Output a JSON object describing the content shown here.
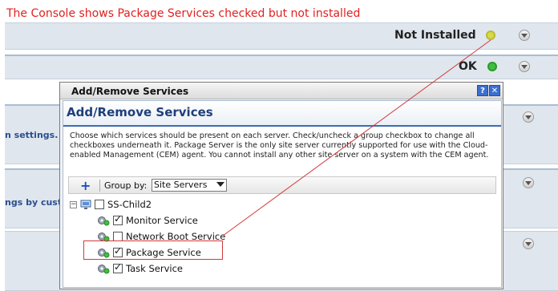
{
  "caption": "The Console shows Package Services checked but not installed",
  "console": {
    "rows": [
      {
        "status": "Not Installed",
        "indicator_color": "#d6d94a"
      },
      {
        "status": "OK",
        "indicator_color": "#3fbf3f"
      }
    ],
    "labels": [
      "n settings.",
      "ngs by cust"
    ]
  },
  "dialog": {
    "title": "Add/Remove Services",
    "help_label": "?",
    "close_label": "✕",
    "header": "Add/Remove Services",
    "description": "Choose which services should be present on each server. Check/uncheck a group checkbox to change all checkboxes underneath it. Package Server is the only site server currently supported for use with the Cloud-enabled Management (CEM) agent. You cannot install any other site server on a system with the CEM agent.",
    "toolbar": {
      "add_icon": "+",
      "group_by_label": "Group by:",
      "group_by_value": "Site Servers"
    },
    "tree": {
      "expander": "−",
      "root": {
        "label": "SS-Child2",
        "checked": false
      },
      "services": [
        {
          "label": "Monitor Service",
          "checked": true
        },
        {
          "label": "Network Boot Service",
          "checked": false
        },
        {
          "label": "Package Service",
          "checked": true
        },
        {
          "label": "Task Service",
          "checked": true
        }
      ]
    }
  }
}
